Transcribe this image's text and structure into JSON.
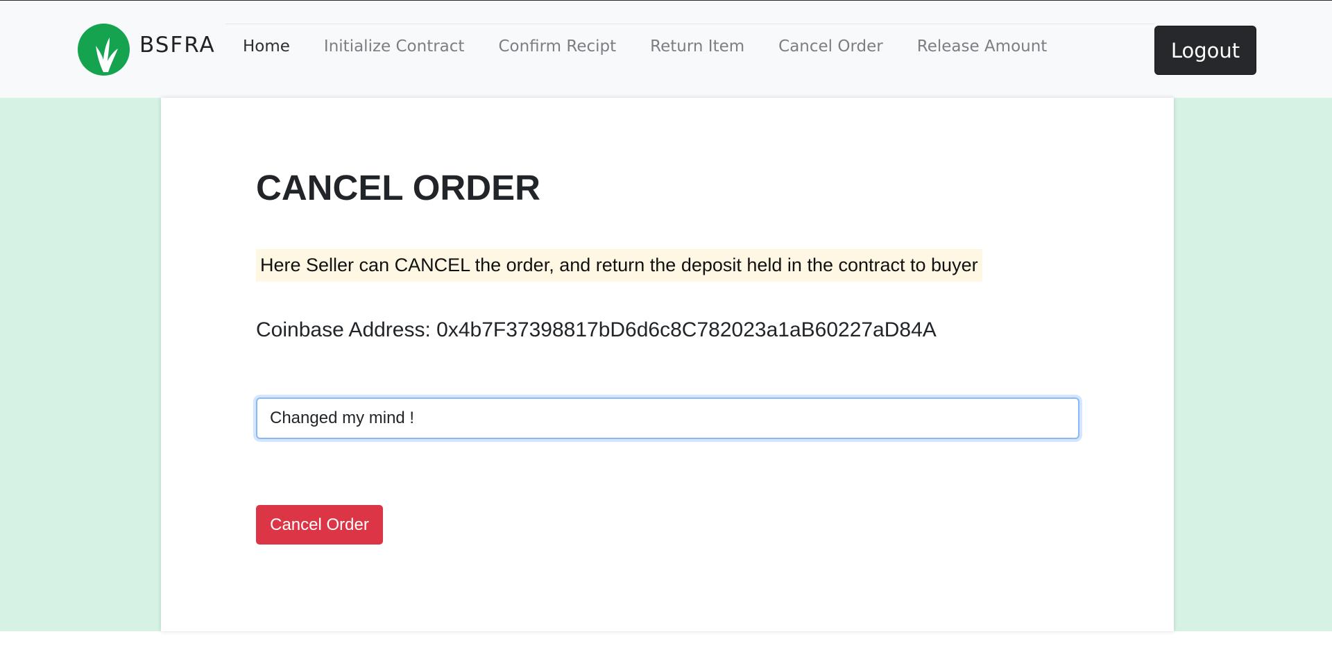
{
  "brand": {
    "name": "BSFRA"
  },
  "nav": {
    "items": [
      {
        "label": "Home",
        "active": true
      },
      {
        "label": "Initialize Contract"
      },
      {
        "label": "Confirm Recipt"
      },
      {
        "label": "Return Item"
      },
      {
        "label": "Cancel Order"
      },
      {
        "label": "Release Amount"
      }
    ],
    "logout_label": "Logout"
  },
  "main": {
    "title": "CANCEL ORDER",
    "notice": "Here Seller can CANCEL the order, and return the deposit held in the contract to buyer",
    "address_label": "Coinbase Address:",
    "address_value": "0x4b7F37398817bD6d6c8C782023a1aB60227aD84A",
    "reason_input_value": "Changed my mind !",
    "cancel_button_label": "Cancel Order"
  },
  "colors": {
    "brand_green": "#15a34f",
    "background_mint": "#d6f2e5",
    "danger": "#dc3545",
    "notice_highlight": "#fdf7e3",
    "logout_dark": "#26282b"
  }
}
